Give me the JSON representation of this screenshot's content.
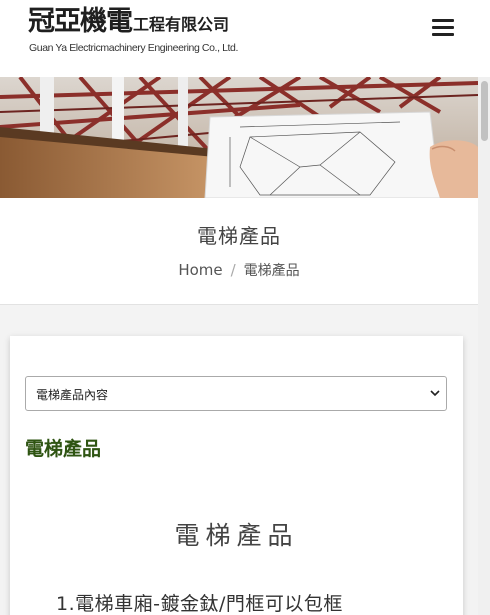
{
  "header": {
    "logo_main": "冠亞機電",
    "logo_suffix": "工程有限公司",
    "logo_subtitle": "Guan Ya Electricmachinery Engineering Co., Ltd."
  },
  "title_section": {
    "page_title": "電梯產品",
    "breadcrumb": {
      "home": "Home",
      "separator": "/",
      "current": "電梯產品"
    }
  },
  "content": {
    "select": {
      "selected": "電梯產品內容"
    },
    "section_heading": "電梯產品",
    "big_heading": "電梯產品",
    "list_item_1": "1.電梯車廂-鍍金鈦/門框可以包框"
  },
  "colors": {
    "accent_green": "#2e5412",
    "header_bg": "#ffffff",
    "page_bg": "#f3f3f3"
  },
  "icons": {
    "menu": "hamburger-menu-icon",
    "select_arrow": "chevron-down-icon"
  }
}
